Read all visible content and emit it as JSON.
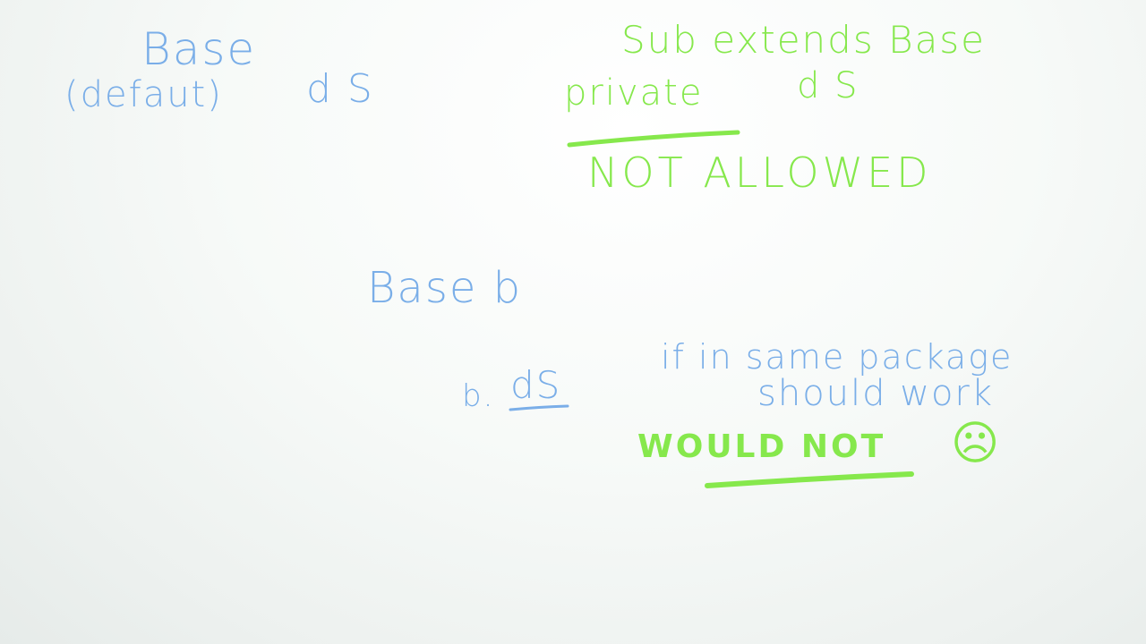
{
  "colors": {
    "blue_marker": "#7aaee8",
    "green_marker": "#86e84c",
    "board": "#f4f7f5"
  },
  "notes": {
    "base_heading": "Base",
    "default_label": "(defaut)",
    "base_field": "d S",
    "sub_heading": "Sub extends Base",
    "private_label": "private",
    "sub_field": "d S",
    "not_allowed": "NOT ALLOWED",
    "base_var": "Base b",
    "access_expr_prefix": "b.",
    "access_expr_field": "dS",
    "same_package_line1": "if in same package",
    "same_package_line2": "should work",
    "would_not": "WOULD NOT",
    "sad_face": "☹"
  }
}
